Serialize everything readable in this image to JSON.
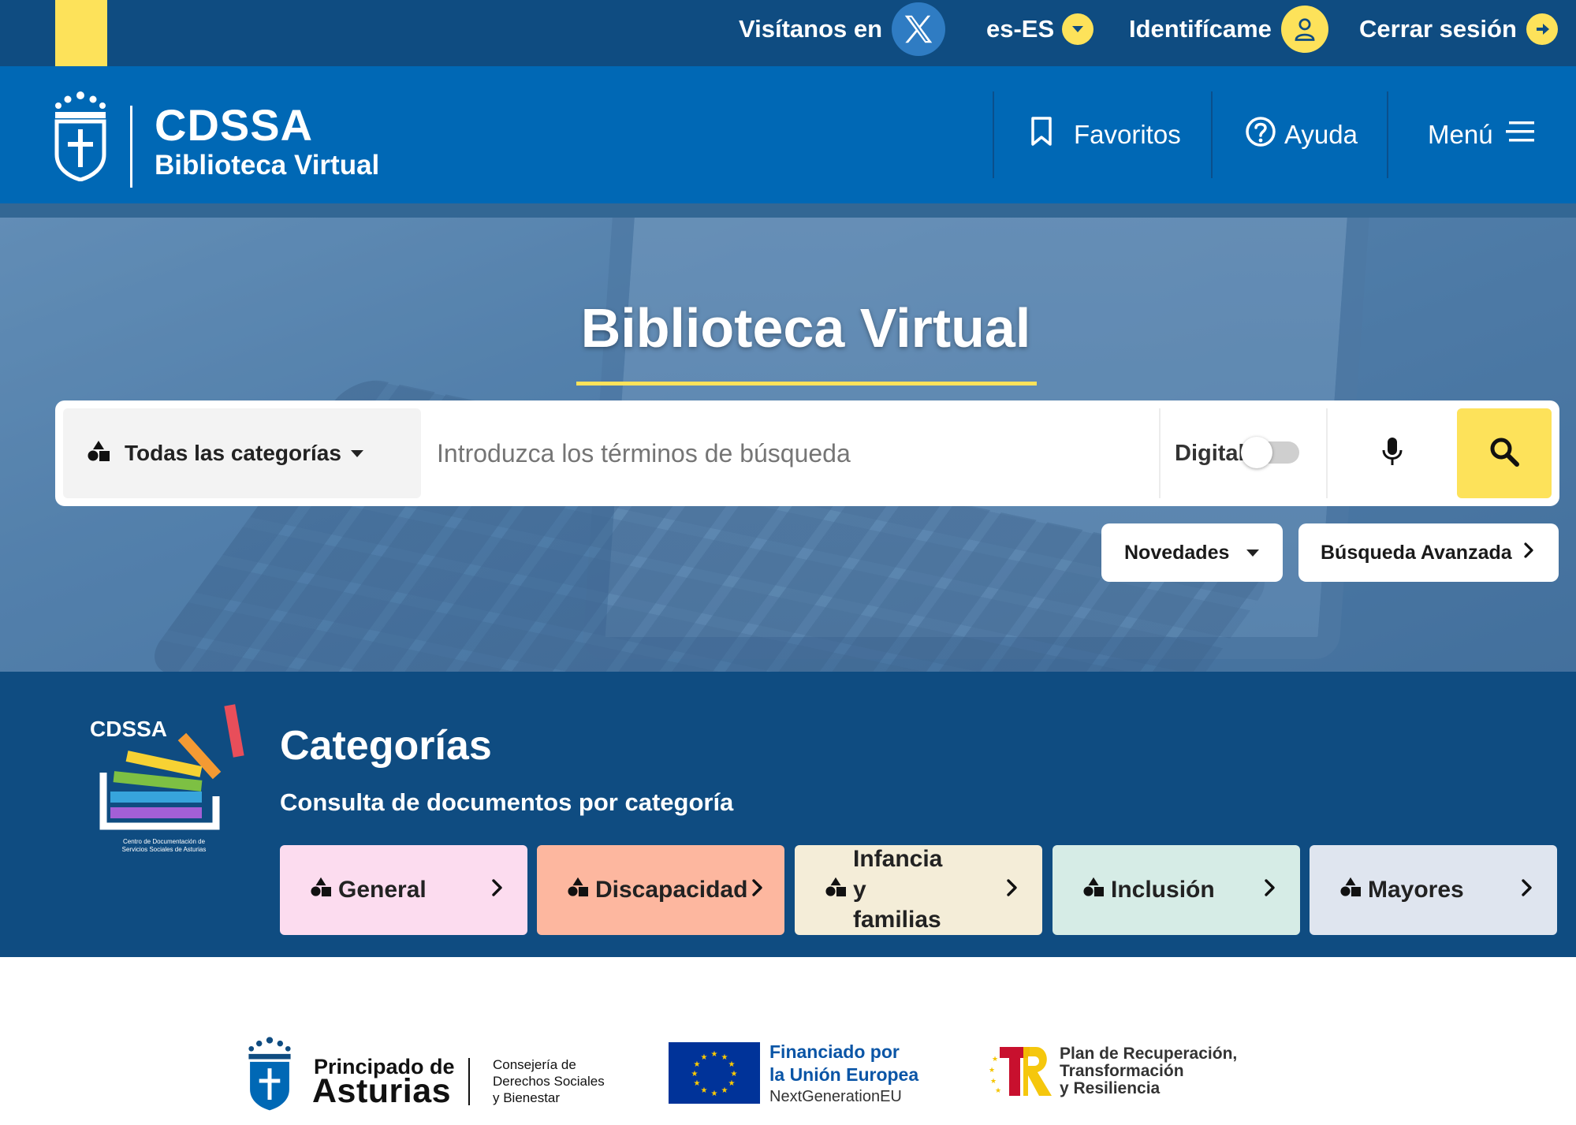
{
  "topbar": {
    "visit_label": "Visítanos en",
    "language": "es-ES",
    "login_label": "Identifícame",
    "logout_label": "Cerrar sesión",
    "accent_color": "#fde25a",
    "background_color": "#0f4c81"
  },
  "header": {
    "brand_title": "CDSSA",
    "brand_subtitle": "Biblioteca Virtual",
    "favorites_label": "Favoritos",
    "help_label": "Ayuda",
    "menu_label": "Menú",
    "background_color": "#0068b5"
  },
  "hero": {
    "title": "Biblioteca Virtual",
    "category_select": "Todas las categorías",
    "search_placeholder": "Introduzca los términos de búsqueda",
    "search_value": "",
    "digital_label": "Digital",
    "digital_toggle_on": false,
    "novedades_label": "Novedades",
    "advanced_search_label": "Búsqueda Avanzada"
  },
  "categories": {
    "title": "Categorías",
    "subtitle": "Consulta de documentos por categoría",
    "logo_text": "CDSSA",
    "logo_caption_1": "Centro de Documentación de",
    "logo_caption_2": "Servicios Sociales de Asturias",
    "items": [
      {
        "label": "General",
        "color": "#fcdcef"
      },
      {
        "label": "Discapacidad",
        "color": "#fdb79f"
      },
      {
        "label": "Infancia y familias",
        "color": "#f4edd8"
      },
      {
        "label": "Inclusión",
        "color": "#d6ece6"
      },
      {
        "label": "Mayores",
        "color": "#dfe5ef"
      }
    ]
  },
  "footer": {
    "asturias_line1": "Principado de",
    "asturias_line2": "Asturias",
    "consejeria": [
      "Consejería de",
      "Derechos Sociales",
      "y Bienestar"
    ],
    "eu_line1": "Financiado por",
    "eu_line2": "la Unión Europea",
    "eu_line3": "NextGenerationEU",
    "prtr": [
      "Plan de Recuperación,",
      "Transformación",
      "y Resiliencia"
    ]
  },
  "icons": {
    "x": "x-logo-icon",
    "language": "chevron-down-icon",
    "login": "user-icon",
    "logout": "logout-icon",
    "favorites": "bookmark-icon",
    "help": "help-circle-icon",
    "menu": "hamburger-icon",
    "categories": "shapes-icon",
    "mic": "microphone-icon",
    "search": "search-icon",
    "chevron": "chevron-right-icon"
  }
}
